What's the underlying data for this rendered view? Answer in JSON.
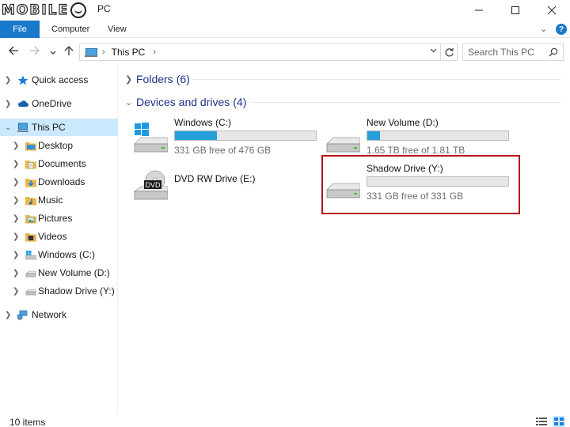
{
  "window": {
    "logo_text": "MOBILE",
    "title": "PC",
    "minimize_icon": "minimize-icon",
    "maximize_icon": "maximize-icon",
    "close_icon": "close-icon"
  },
  "ribbon": {
    "tabs": [
      {
        "label": "File",
        "active": true
      },
      {
        "label": "Computer"
      },
      {
        "label": "View"
      }
    ],
    "accent_color": "#1979ca",
    "help_label": "?"
  },
  "navigation": {
    "back_icon": "arrow-left-icon",
    "forward_icon": "arrow-right-icon",
    "recent_icon": "chevron-down-icon",
    "up_icon": "arrow-up-icon",
    "address": {
      "path": [
        "This PC"
      ]
    },
    "search": {
      "placeholder": "Search This PC"
    }
  },
  "sidebar": {
    "items": [
      {
        "label": "Quick access",
        "icon": "star-icon",
        "level": 0
      },
      {
        "label": "OneDrive",
        "icon": "cloud-icon",
        "level": 0
      },
      {
        "label": "This PC",
        "icon": "computer-icon",
        "level": 0,
        "selected": true,
        "expanded": true
      },
      {
        "label": "Desktop",
        "icon": "desktop-folder-icon",
        "level": 1
      },
      {
        "label": "Documents",
        "icon": "documents-folder-icon",
        "level": 1
      },
      {
        "label": "Downloads",
        "icon": "downloads-folder-icon",
        "level": 1
      },
      {
        "label": "Music",
        "icon": "music-folder-icon",
        "level": 1
      },
      {
        "label": "Pictures",
        "icon": "pictures-folder-icon",
        "level": 1
      },
      {
        "label": "Videos",
        "icon": "videos-folder-icon",
        "level": 1
      },
      {
        "label": "Windows (C:)",
        "icon": "windows-drive-icon",
        "level": 1
      },
      {
        "label": "New Volume (D:)",
        "icon": "drive-icon",
        "level": 1
      },
      {
        "label": "Shadow Drive (Y:)",
        "icon": "drive-icon",
        "level": 1
      },
      {
        "label": "Network",
        "icon": "network-icon",
        "level": 0
      }
    ],
    "selected_color": "#cce8ff"
  },
  "main": {
    "groups": [
      {
        "title": "Folders",
        "count": "(6)",
        "expanded": false
      },
      {
        "title": "Devices and drives",
        "count": "(4)",
        "expanded": true
      }
    ],
    "drives": [
      {
        "name": "Windows (C:)",
        "free_text": "331 GB free of 476 GB",
        "used_fraction": 0.3,
        "icon": "windows-drive-icon"
      },
      {
        "name": "New Volume (D:)",
        "free_text": "1.65 TB free of 1.81 TB",
        "used_fraction": 0.09,
        "icon": "drive-icon"
      },
      {
        "name": "DVD RW Drive (E:)",
        "icon": "dvd-drive-icon",
        "dvd_label": "DVD"
      },
      {
        "name": "Shadow Drive (Y:)",
        "free_text": "331 GB free of 331 GB",
        "used_fraction": 0.0,
        "icon": "drive-icon",
        "highlighted": true
      }
    ],
    "bar_color": "#26a0da",
    "highlight_color": "#b5121b"
  },
  "status": {
    "item_count": "10 items",
    "details_view_icon": "details-view-icon",
    "large_icons_view_icon": "large-icons-view-icon"
  }
}
